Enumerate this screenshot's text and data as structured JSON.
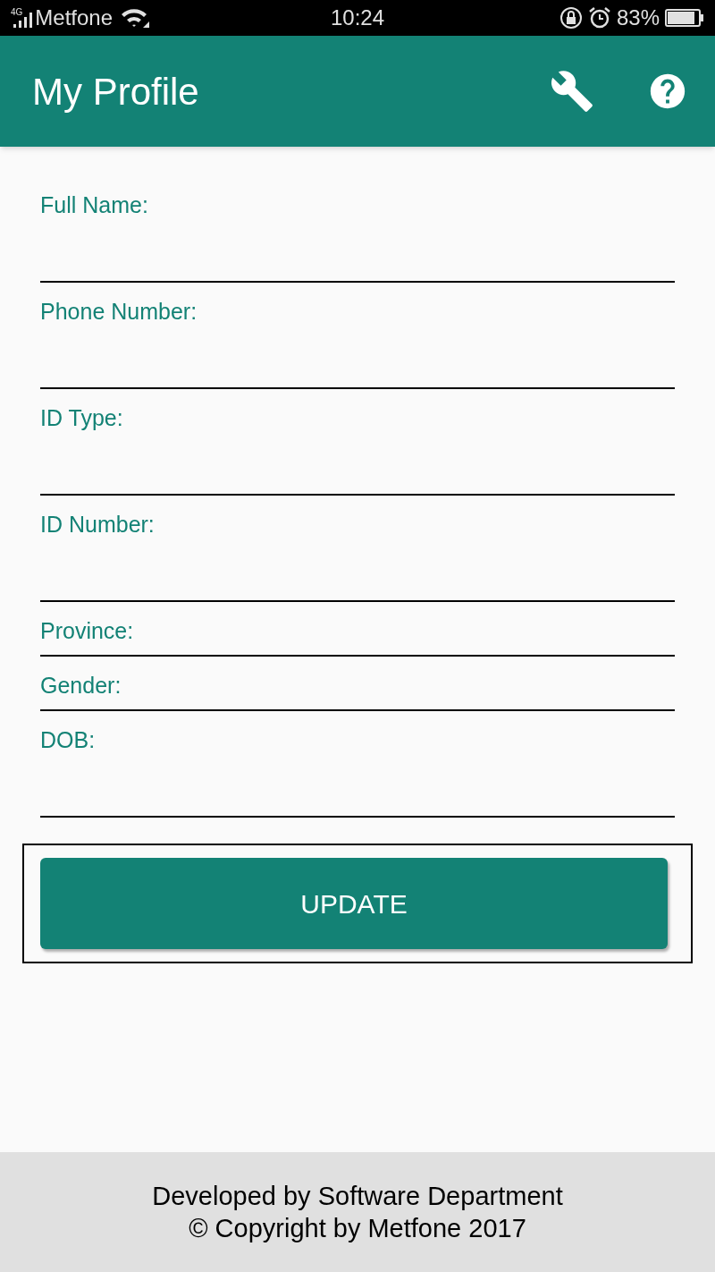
{
  "status_bar": {
    "network": "4G",
    "carrier": "Metfone",
    "time": "10:24",
    "battery": "83%"
  },
  "app_bar": {
    "title": "My Profile"
  },
  "fields": [
    {
      "label": "Full Name:",
      "kind": "text"
    },
    {
      "label": "Phone Number:",
      "kind": "text"
    },
    {
      "label": "ID Type:",
      "kind": "text"
    },
    {
      "label": "ID Number:",
      "kind": "text"
    },
    {
      "label": "Province:",
      "kind": "select"
    },
    {
      "label": "Gender:",
      "kind": "select"
    },
    {
      "label": "DOB:",
      "kind": "text"
    }
  ],
  "update_button": "UPDATE",
  "footer": [
    "Developed by Software Department",
    "© Copyright by Metfone 2017"
  ]
}
